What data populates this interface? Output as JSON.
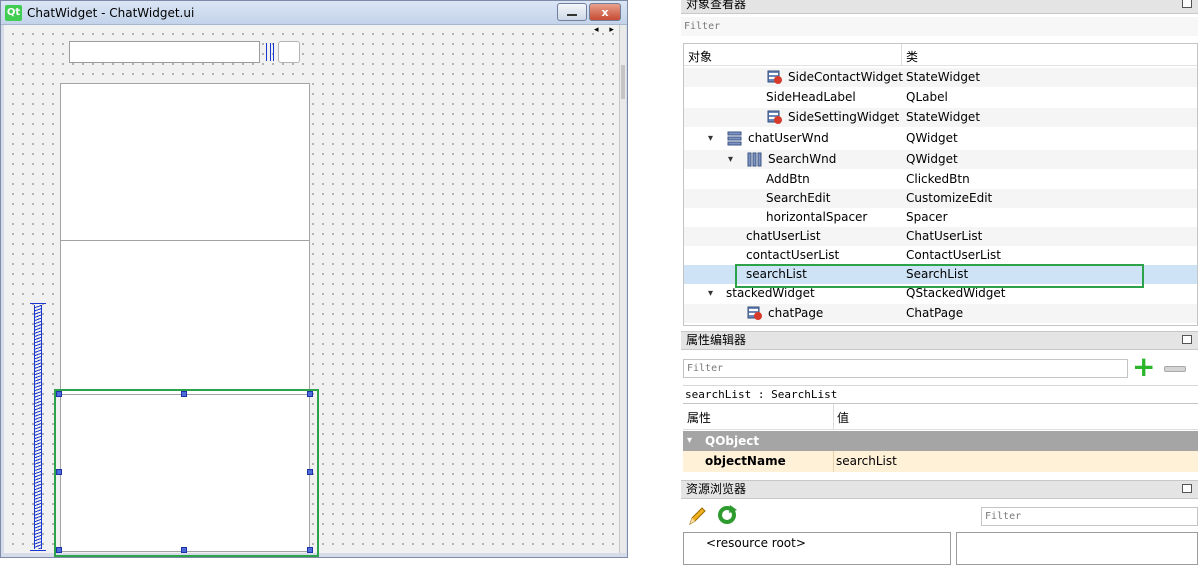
{
  "form_window": {
    "title": "ChatWidget - ChatWidget.ui",
    "logo_text": "Qt",
    "close_label": "x",
    "nav_arrows": "◂ ▸"
  },
  "object_inspector": {
    "title": "对象查看器",
    "filter_placeholder": "Filter",
    "header_object": "对象",
    "header_class": "类",
    "rows": [
      {
        "name": "SideContactWidget",
        "class": "StateWidget"
      },
      {
        "name": "SideHeadLabel",
        "class": "QLabel"
      },
      {
        "name": "SideSettingWidget",
        "class": "StateWidget"
      },
      {
        "name": "chatUserWnd",
        "class": "QWidget"
      },
      {
        "name": "SearchWnd",
        "class": "QWidget"
      },
      {
        "name": "AddBtn",
        "class": "ClickedBtn"
      },
      {
        "name": "SearchEdit",
        "class": "CustomizeEdit"
      },
      {
        "name": "horizontalSpacer",
        "class": "Spacer"
      },
      {
        "name": "chatUserList",
        "class": "ChatUserList"
      },
      {
        "name": "contactUserList",
        "class": "ContactUserList"
      },
      {
        "name": "searchList",
        "class": "SearchList"
      },
      {
        "name": "stackedWidget",
        "class": "QStackedWidget"
      },
      {
        "name": "chatPage",
        "class": "ChatPage"
      }
    ]
  },
  "property_editor": {
    "title": "属性编辑器",
    "filter_placeholder": "Filter",
    "object_label": "searchList : SearchList",
    "header_property": "属性",
    "header_value": "值",
    "group": "QObject",
    "property_name": "objectName",
    "property_value": "searchList"
  },
  "resource_browser": {
    "title": "资源浏览器",
    "filter_placeholder": "Filter",
    "root_label": "<resource root>"
  },
  "colors": {
    "selection_outline": "#2ca24a",
    "selected_row": "#cfe3f7",
    "handle": "#4d6ad8",
    "spacer": "#1a37d0"
  }
}
